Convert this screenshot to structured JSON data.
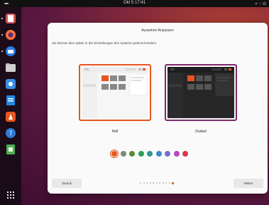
{
  "topbar": {
    "clock": "Okt 5  17:41"
  },
  "dock": {
    "items": [
      {
        "name": "app-center-icon",
        "color": "#d9534f"
      },
      {
        "name": "firefox-icon",
        "color": "#ff7139"
      },
      {
        "name": "thunderbird-icon",
        "color": "#2a7ae2"
      },
      {
        "name": "files-icon",
        "color": "#e0e0e0"
      },
      {
        "name": "rhythmbox-icon",
        "color": "#3a8ee6"
      },
      {
        "name": "writer-icon",
        "color": "#1e88e5"
      },
      {
        "name": "software-icon",
        "color": "#e95420"
      },
      {
        "name": "help-icon",
        "color": "#2f7bd8"
      },
      {
        "name": "trash-icon",
        "color": "#4caf50"
      }
    ],
    "show_apps": "apps-grid-icon"
  },
  "dialog": {
    "title": "Aussehen Anpassen",
    "subtitle": "Sie können dies später in der Einstellungen des Systems jederzeit ändern.",
    "themes": [
      {
        "label": "Hell",
        "selected": true
      },
      {
        "label": "Dunkel",
        "selected": false
      }
    ],
    "accents": [
      {
        "color": "#e95420",
        "selected": true
      },
      {
        "color": "#7a8a7a",
        "selected": false
      },
      {
        "color": "#5a8a3a",
        "selected": false
      },
      {
        "color": "#2aa05a",
        "selected": false
      },
      {
        "color": "#2a9a8a",
        "selected": false
      },
      {
        "color": "#3a8acb",
        "selected": false
      },
      {
        "color": "#7a6ad0",
        "selected": false
      },
      {
        "color": "#b04ac0",
        "selected": false
      },
      {
        "color": "#d9364a",
        "selected": false
      }
    ],
    "back_label": "Zurück",
    "next_label": "Weiter",
    "progress": {
      "total": 11,
      "current": 11
    }
  }
}
